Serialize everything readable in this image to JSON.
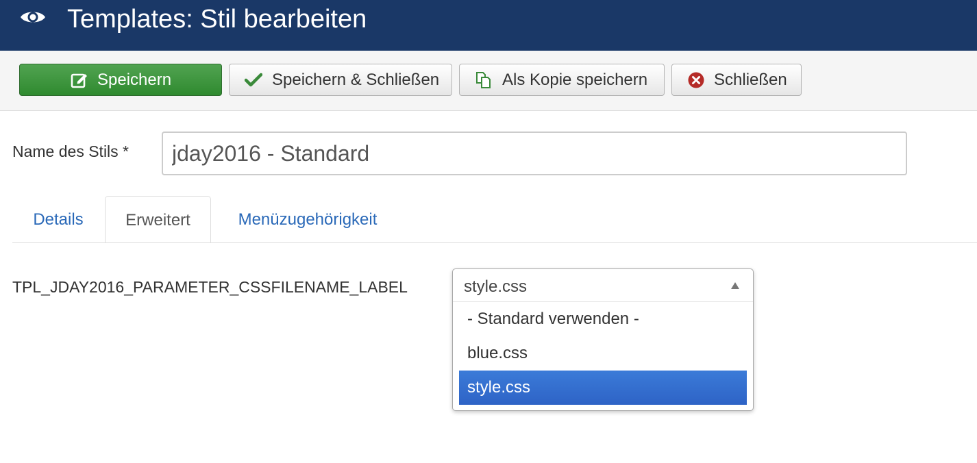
{
  "header": {
    "title": "Templates: Stil bearbeiten",
    "icon": "eye-icon",
    "background_color": "#1a3867"
  },
  "toolbar": {
    "save_label": "Speichern",
    "save_close_label": "Speichern & Schließen",
    "save_copy_label": "Als Kopie speichern",
    "close_label": "Schließen",
    "save_color": "#3c9a3c",
    "close_icon_color": "#b52b27"
  },
  "form": {
    "style_name_label": "Name des Stils *",
    "style_name_value": "jday2016 - Standard"
  },
  "tabs": [
    {
      "label": "Details",
      "active": false
    },
    {
      "label": "Erweitert",
      "active": true
    },
    {
      "label": "Menüzugehörigkeit",
      "active": false
    }
  ],
  "advanced": {
    "css_filename_label": "TPL_JDAY2016_PARAMETER_CSSFILENAME_LABEL",
    "css_filename_selected": "style.css",
    "css_filename_options": [
      "- Standard verwenden -",
      "blue.css",
      "style.css"
    ],
    "highlight_color": "#3370d0"
  }
}
